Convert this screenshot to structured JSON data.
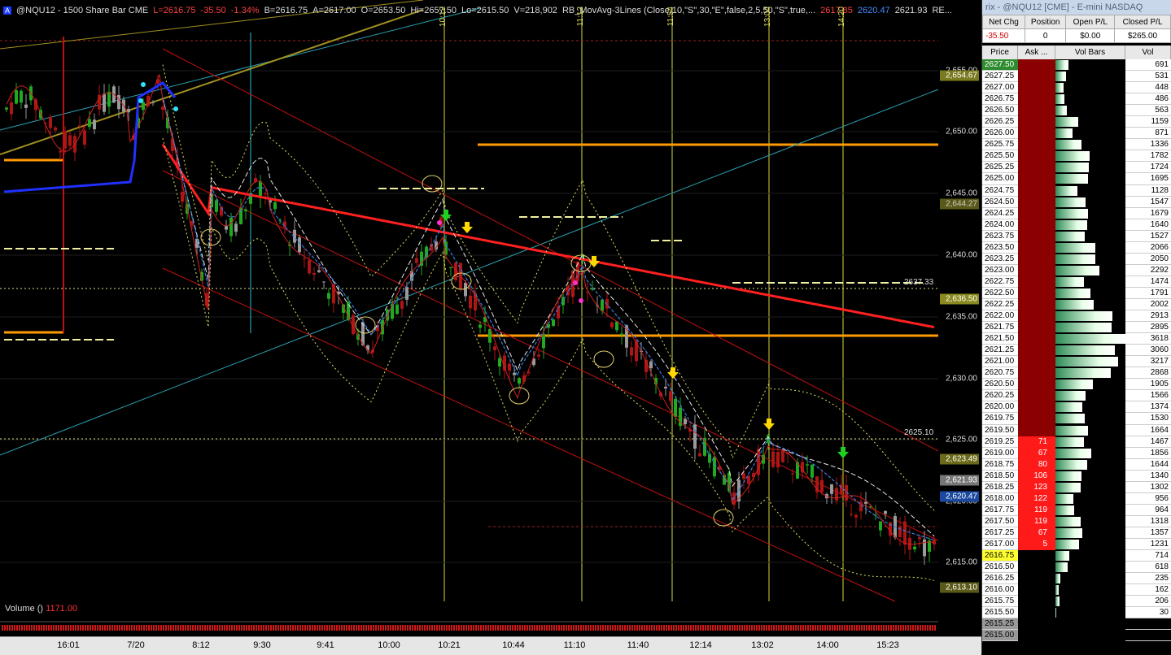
{
  "status": {
    "badge": "A",
    "symbol": "@NQU12 - 1500 Share Bar",
    "exchange": "CME",
    "last": "L=2616.75",
    "chg": "-35.50",
    "pct": "-1.34%",
    "bid": "B=2616.75",
    "ask": "A=2617.00",
    "open": "O=2653.50",
    "high": "Hi=2657.50",
    "low": "Lo=2615.50",
    "vol": "V=218,902",
    "study": "RB_MovAvg-3Lines (Close,10,\"S\",30,\"E\",false,2,5,50,\"S\",true,...",
    "v1": "2617.85",
    "v2": "2620.47",
    "v3": "2621.93",
    "v4": "RE..."
  },
  "volume_label": "Volume ()",
  "volume_value": "1171.00",
  "time_axis": [
    "16:01",
    "7/20",
    "8:12",
    "9:30",
    "9:41",
    "10:00",
    "10:21",
    "10:44",
    "11:10",
    "11:40",
    "12:14",
    "13:02",
    "14:00",
    "15:23"
  ],
  "time_marks": [
    "10:12",
    "11:12",
    "11:54",
    "13:04",
    "14:20"
  ],
  "price_ticks": [
    "2,655.00",
    "2,650.00",
    "2,645.00",
    "2,640.00",
    "2,635.00",
    "2,630.00",
    "2,625.00",
    "2,620.00",
    "2,615.00"
  ],
  "line_labels": [
    "2637.33",
    "2625.10"
  ],
  "price_tags": [
    {
      "text": "2,654.67",
      "bg": "#7a7a20",
      "fg": "#ffffff"
    },
    {
      "text": "2,644.27",
      "bg": "#5a5a18",
      "fg": "#cccccc"
    },
    {
      "text": "2,636.50",
      "bg": "#8a8a20",
      "fg": "#ffffff"
    },
    {
      "text": "2,623.49",
      "bg": "#6a6a1a",
      "fg": "#ffffff"
    },
    {
      "text": "2,621.93",
      "bg": "#777777",
      "fg": "#ffffff"
    },
    {
      "text": "2,620.47",
      "bg": "#1a4aa0",
      "fg": "#ffffff"
    },
    {
      "text": "2,613.10",
      "bg": "#5a5a18",
      "fg": "#ffffff"
    }
  ],
  "colors": {
    "up_candle": "#1faa1f",
    "down_candle": "#b01515",
    "neutral_candle": "#9a9a9a",
    "ma_slow": "#ff2020",
    "ma_mid": "#e8e8e8",
    "ma_fast": "#3a7ae0",
    "support_line": "#ff9a00",
    "channel": "#c01010",
    "trendline": "#2aa0b0"
  },
  "dom": {
    "title": "rix - @NQU12 [CME] - E-mini NASDAQ",
    "stats_headers": [
      "Net Chg",
      "Position",
      "Open P/L",
      "Closed P/L"
    ],
    "stats_values": [
      "-35.50",
      "0",
      "$0.00",
      "$265.00"
    ],
    "columns": [
      "Price",
      "Ask ...",
      "Vol Bars",
      "Vol"
    ],
    "rows": [
      {
        "price": "2627.50",
        "ask": "",
        "vol": "691",
        "bar": 0.19,
        "last": true
      },
      {
        "price": "2627.25",
        "ask": "",
        "vol": "531",
        "bar": 0.15
      },
      {
        "price": "2627.00",
        "ask": "",
        "vol": "448",
        "bar": 0.12
      },
      {
        "price": "2626.75",
        "ask": "",
        "vol": "486",
        "bar": 0.13
      },
      {
        "price": "2626.50",
        "ask": "",
        "vol": "563",
        "bar": 0.16
      },
      {
        "price": "2626.25",
        "ask": "",
        "vol": "1159",
        "bar": 0.32
      },
      {
        "price": "2626.00",
        "ask": "",
        "vol": "871",
        "bar": 0.24
      },
      {
        "price": "2625.75",
        "ask": "",
        "vol": "1336",
        "bar": 0.37
      },
      {
        "price": "2625.50",
        "ask": "",
        "vol": "1782",
        "bar": 0.49
      },
      {
        "price": "2625.25",
        "ask": "",
        "vol": "1724",
        "bar": 0.48
      },
      {
        "price": "2625.00",
        "ask": "",
        "vol": "1695",
        "bar": 0.47
      },
      {
        "price": "2624.75",
        "ask": "",
        "vol": "1128",
        "bar": 0.31
      },
      {
        "price": "2624.50",
        "ask": "",
        "vol": "1547",
        "bar": 0.43
      },
      {
        "price": "2624.25",
        "ask": "",
        "vol": "1679",
        "bar": 0.46
      },
      {
        "price": "2624.00",
        "ask": "",
        "vol": "1640",
        "bar": 0.45
      },
      {
        "price": "2623.75",
        "ask": "",
        "vol": "1527",
        "bar": 0.42
      },
      {
        "price": "2623.50",
        "ask": "",
        "vol": "2066",
        "bar": 0.57
      },
      {
        "price": "2623.25",
        "ask": "",
        "vol": "2050",
        "bar": 0.57
      },
      {
        "price": "2623.00",
        "ask": "",
        "vol": "2292",
        "bar": 0.63
      },
      {
        "price": "2622.75",
        "ask": "",
        "vol": "1474",
        "bar": 0.41
      },
      {
        "price": "2622.50",
        "ask": "",
        "vol": "1791",
        "bar": 0.5
      },
      {
        "price": "2622.25",
        "ask": "",
        "vol": "2002",
        "bar": 0.55
      },
      {
        "price": "2622.00",
        "ask": "",
        "vol": "2913",
        "bar": 0.81
      },
      {
        "price": "2621.75",
        "ask": "",
        "vol": "2895",
        "bar": 0.8
      },
      {
        "price": "2621.50",
        "ask": "",
        "vol": "3618",
        "bar": 1.0
      },
      {
        "price": "2621.25",
        "ask": "",
        "vol": "3060",
        "bar": 0.85
      },
      {
        "price": "2621.00",
        "ask": "",
        "vol": "3217",
        "bar": 0.89
      },
      {
        "price": "2620.75",
        "ask": "",
        "vol": "2868",
        "bar": 0.79
      },
      {
        "price": "2620.50",
        "ask": "",
        "vol": "1905",
        "bar": 0.53
      },
      {
        "price": "2620.25",
        "ask": "",
        "vol": "1566",
        "bar": 0.43
      },
      {
        "price": "2620.00",
        "ask": "",
        "vol": "1374",
        "bar": 0.38
      },
      {
        "price": "2619.75",
        "ask": "",
        "vol": "1530",
        "bar": 0.42
      },
      {
        "price": "2619.50",
        "ask": "",
        "vol": "1664",
        "bar": 0.46
      },
      {
        "price": "2619.25",
        "ask": "71",
        "vol": "1467",
        "bar": 0.41
      },
      {
        "price": "2619.00",
        "ask": "67",
        "vol": "1856",
        "bar": 0.51
      },
      {
        "price": "2618.75",
        "ask": "80",
        "vol": "1644",
        "bar": 0.45
      },
      {
        "price": "2618.50",
        "ask": "106",
        "vol": "1340",
        "bar": 0.37
      },
      {
        "price": "2618.25",
        "ask": "123",
        "vol": "1302",
        "bar": 0.36
      },
      {
        "price": "2618.00",
        "ask": "122",
        "vol": "956",
        "bar": 0.26
      },
      {
        "price": "2617.75",
        "ask": "119",
        "vol": "964",
        "bar": 0.27
      },
      {
        "price": "2617.50",
        "ask": "119",
        "vol": "1318",
        "bar": 0.36
      },
      {
        "price": "2617.25",
        "ask": "67",
        "vol": "1357",
        "bar": 0.38
      },
      {
        "price": "2617.00",
        "ask": "5",
        "vol": "1231",
        "bar": 0.34
      },
      {
        "price": "2616.75",
        "ask": "",
        "vol": "714",
        "bar": 0.2,
        "current": true
      },
      {
        "price": "2616.50",
        "ask": "",
        "vol": "618",
        "bar": 0.17
      },
      {
        "price": "2616.25",
        "ask": "",
        "vol": "235",
        "bar": 0.07
      },
      {
        "price": "2616.00",
        "ask": "",
        "vol": "162",
        "bar": 0.05
      },
      {
        "price": "2615.75",
        "ask": "",
        "vol": "206",
        "bar": 0.06
      },
      {
        "price": "2615.50",
        "ask": "",
        "vol": "30",
        "bar": 0.01
      },
      {
        "price": "2615.25",
        "ask": "",
        "vol": "",
        "bar": 0,
        "grey": true
      },
      {
        "price": "2615.00",
        "ask": "",
        "vol": "",
        "bar": 0,
        "grey": true
      }
    ]
  }
}
